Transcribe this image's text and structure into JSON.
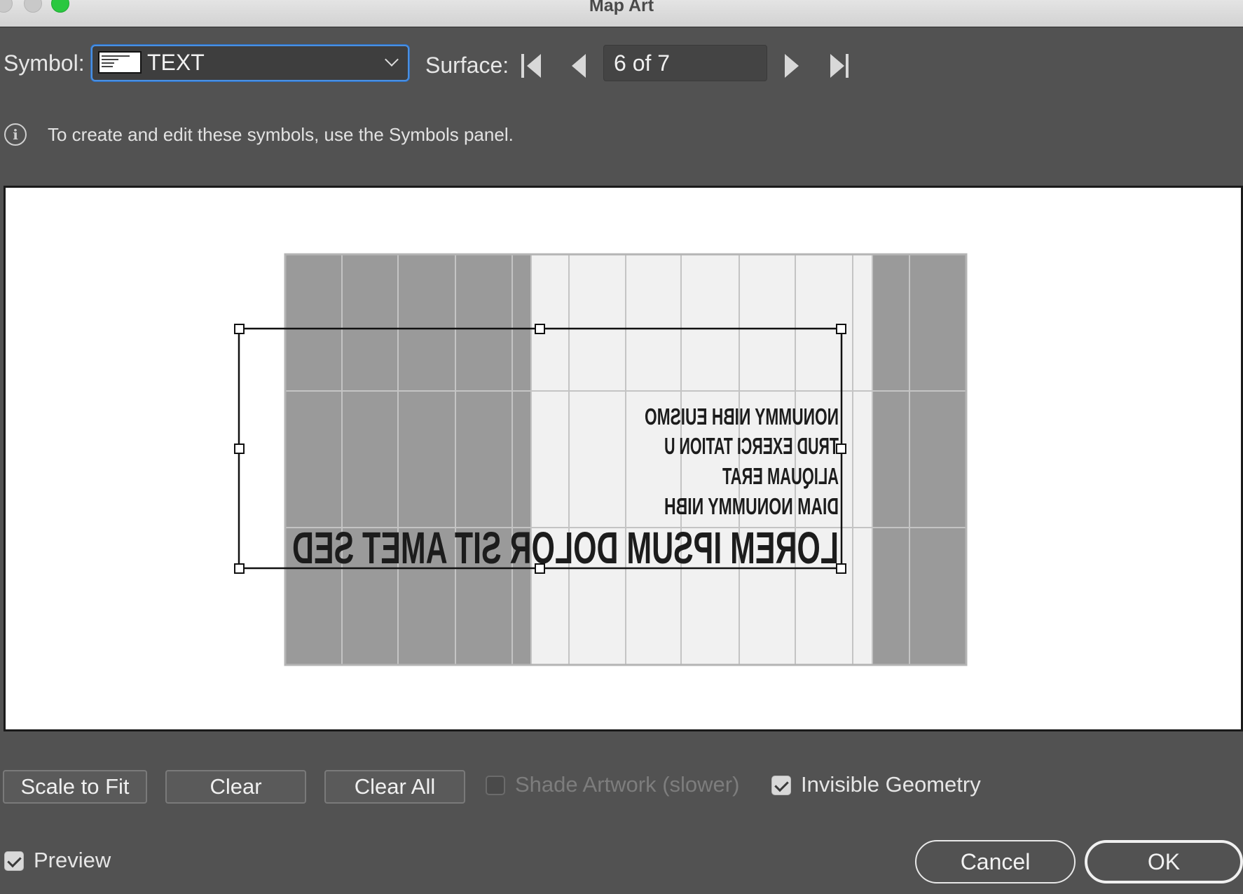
{
  "window": {
    "title": "Map Art"
  },
  "symbol": {
    "label": "Symbol:",
    "value": "TEXT"
  },
  "surface": {
    "label": "Surface:",
    "value": "6 of 7"
  },
  "info": {
    "text": "To create and edit these symbols, use the Symbols panel."
  },
  "artwork": {
    "lines": [
      "NONUMMY NIBH EUISMO",
      "TRUD EXERCI TATION U",
      "ALIQUAM ERAT",
      "DIAM NONUMMY NIBH"
    ],
    "headline": "LOREM IPSUM DOLOR SIT AMET SED"
  },
  "buttons": {
    "scale_to_fit": "Scale to Fit",
    "clear": "Clear",
    "clear_all": "Clear All",
    "cancel": "Cancel",
    "ok": "OK"
  },
  "options": {
    "shade_artwork": {
      "label": "Shade Artwork (slower)",
      "checked": false,
      "enabled": false
    },
    "invisible_geometry": {
      "label": "Invisible Geometry",
      "checked": true
    },
    "preview": {
      "label": "Preview",
      "checked": true
    }
  }
}
